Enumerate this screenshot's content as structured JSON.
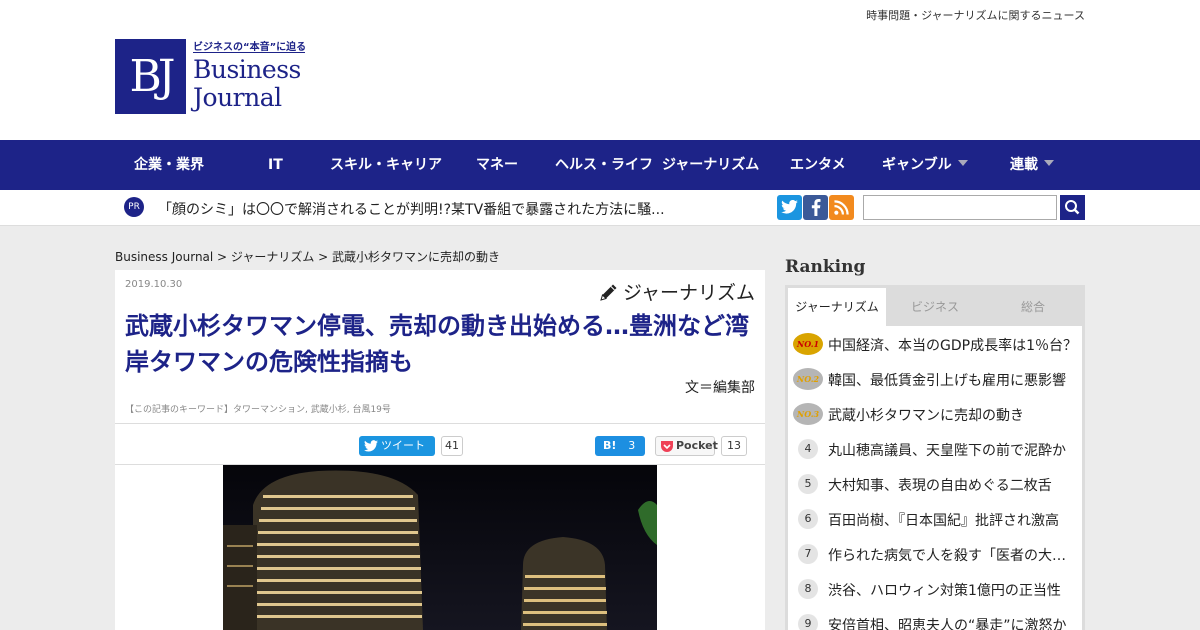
{
  "header": {
    "tagline": "時事問題・ジャーナリズムに関するニュース",
    "logo_mark": "BJ",
    "logo_sub": "ビジネスの“本音”に迫る",
    "logo_name_1": "Business",
    "logo_name_2": "Journal"
  },
  "nav": {
    "items": [
      {
        "label": "企業・業界"
      },
      {
        "label": "IT"
      },
      {
        "label": "スキル・キャリア"
      },
      {
        "label": "マネー"
      },
      {
        "label": "ヘルス・ライフ"
      },
      {
        "label": "ジャーナリズム"
      },
      {
        "label": "エンタメ"
      },
      {
        "label": "ギャンブル"
      },
      {
        "label": "連載"
      }
    ]
  },
  "pr": {
    "badge": "PR",
    "text": "「顔のシミ」は〇〇で解消されることが判明!?某TV番組で暴露された方法に騒..."
  },
  "breadcrumb": {
    "home": "Business Journal",
    "sep1": " > ",
    "section": "ジャーナリズム",
    "sep2": " > ",
    "current": "武蔵小杉タワマンに売却の動き"
  },
  "article": {
    "date": "2019.10.30",
    "category": "ジャーナリズム",
    "title": "武蔵小杉タワマン停電、売却の動き出始める…豊洲など湾岸タワマンの危険性指摘も",
    "author": "文＝編集部",
    "keywords": "【この記事のキーワード】タワーマンション, 武蔵小杉, 台風19号",
    "share": {
      "tweet_label": "ツイート",
      "tweet_count": "41",
      "hatena_label": "B!",
      "hatena_count": "3",
      "pocket_label": "Pocket",
      "pocket_count": "13"
    }
  },
  "ranking": {
    "title": "Ranking",
    "tabs": [
      {
        "label": "ジャーナリズム"
      },
      {
        "label": "ビジネス"
      },
      {
        "label": "総合"
      }
    ],
    "badges": [
      "NO.1",
      "NO.2",
      "NO.3"
    ],
    "items": [
      {
        "rank": "1",
        "text": "中国経済、本当のGDP成長率は1％台？"
      },
      {
        "rank": "2",
        "text": "韓国、最低賃金引上げも雇用に悪影響"
      },
      {
        "rank": "3",
        "text": "武蔵小杉タワマンに売却の動き"
      },
      {
        "rank": "4",
        "text": "丸山穂高議員、天皇陛下の前で泥酔か"
      },
      {
        "rank": "5",
        "text": "大村知事、表現の自由めぐる二枚舌"
      },
      {
        "rank": "6",
        "text": "百田尚樹、『日本国紀』批評され激高"
      },
      {
        "rank": "7",
        "text": "作られた病気で人を殺す「医者の大罪」"
      },
      {
        "rank": "8",
        "text": "渋谷、ハロウィン対策1億円の正当性"
      },
      {
        "rank": "9",
        "text": "安倍首相、昭恵夫人の“暴走”に激怒か"
      }
    ]
  },
  "colors": {
    "brand": "#1d2388",
    "twitter": "#1b95e0",
    "facebook": "#3b5998",
    "rss": "#f28a1e",
    "gold": "#d9a400",
    "silver": "#b5b5b5"
  }
}
